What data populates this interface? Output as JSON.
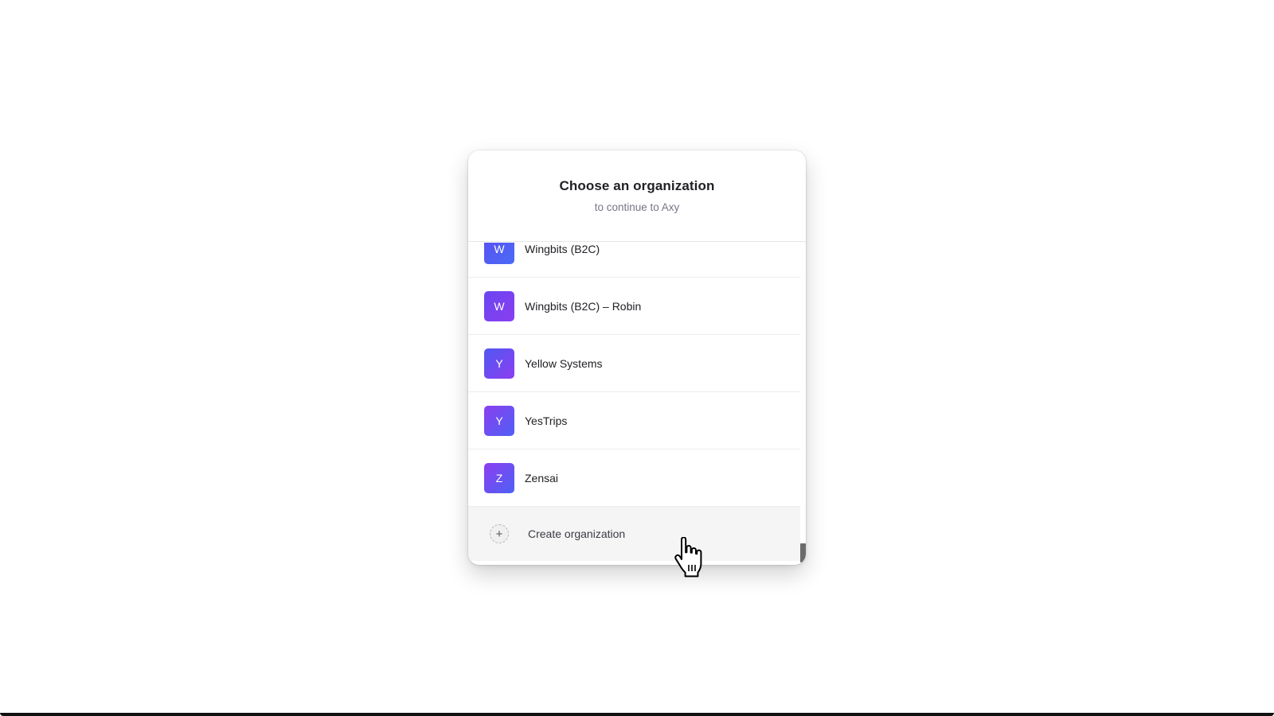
{
  "dialog": {
    "title": "Choose an organization",
    "subtitle": "to continue to Axy"
  },
  "organizations": [
    {
      "initial": "W",
      "name": "Wingbits (B2C)",
      "gradient": [
        "#5b4ef0",
        "#4a6cf7"
      ]
    },
    {
      "initial": "W",
      "name": "Wingbits (B2C) – Robin",
      "gradient": [
        "#6a45f0",
        "#8a3ff0"
      ]
    },
    {
      "initial": "Y",
      "name": "Yellow Systems",
      "gradient": [
        "#4f58f2",
        "#8d3ef0"
      ]
    },
    {
      "initial": "Y",
      "name": "YesTrips",
      "gradient": [
        "#8a3ff0",
        "#4f60f4"
      ]
    },
    {
      "initial": "Z",
      "name": "Zensai",
      "gradient": [
        "#8d3ef0",
        "#4c62f4"
      ]
    }
  ],
  "create": {
    "label": "Create organization",
    "icon": "plus-icon",
    "icon_glyph": "+"
  }
}
